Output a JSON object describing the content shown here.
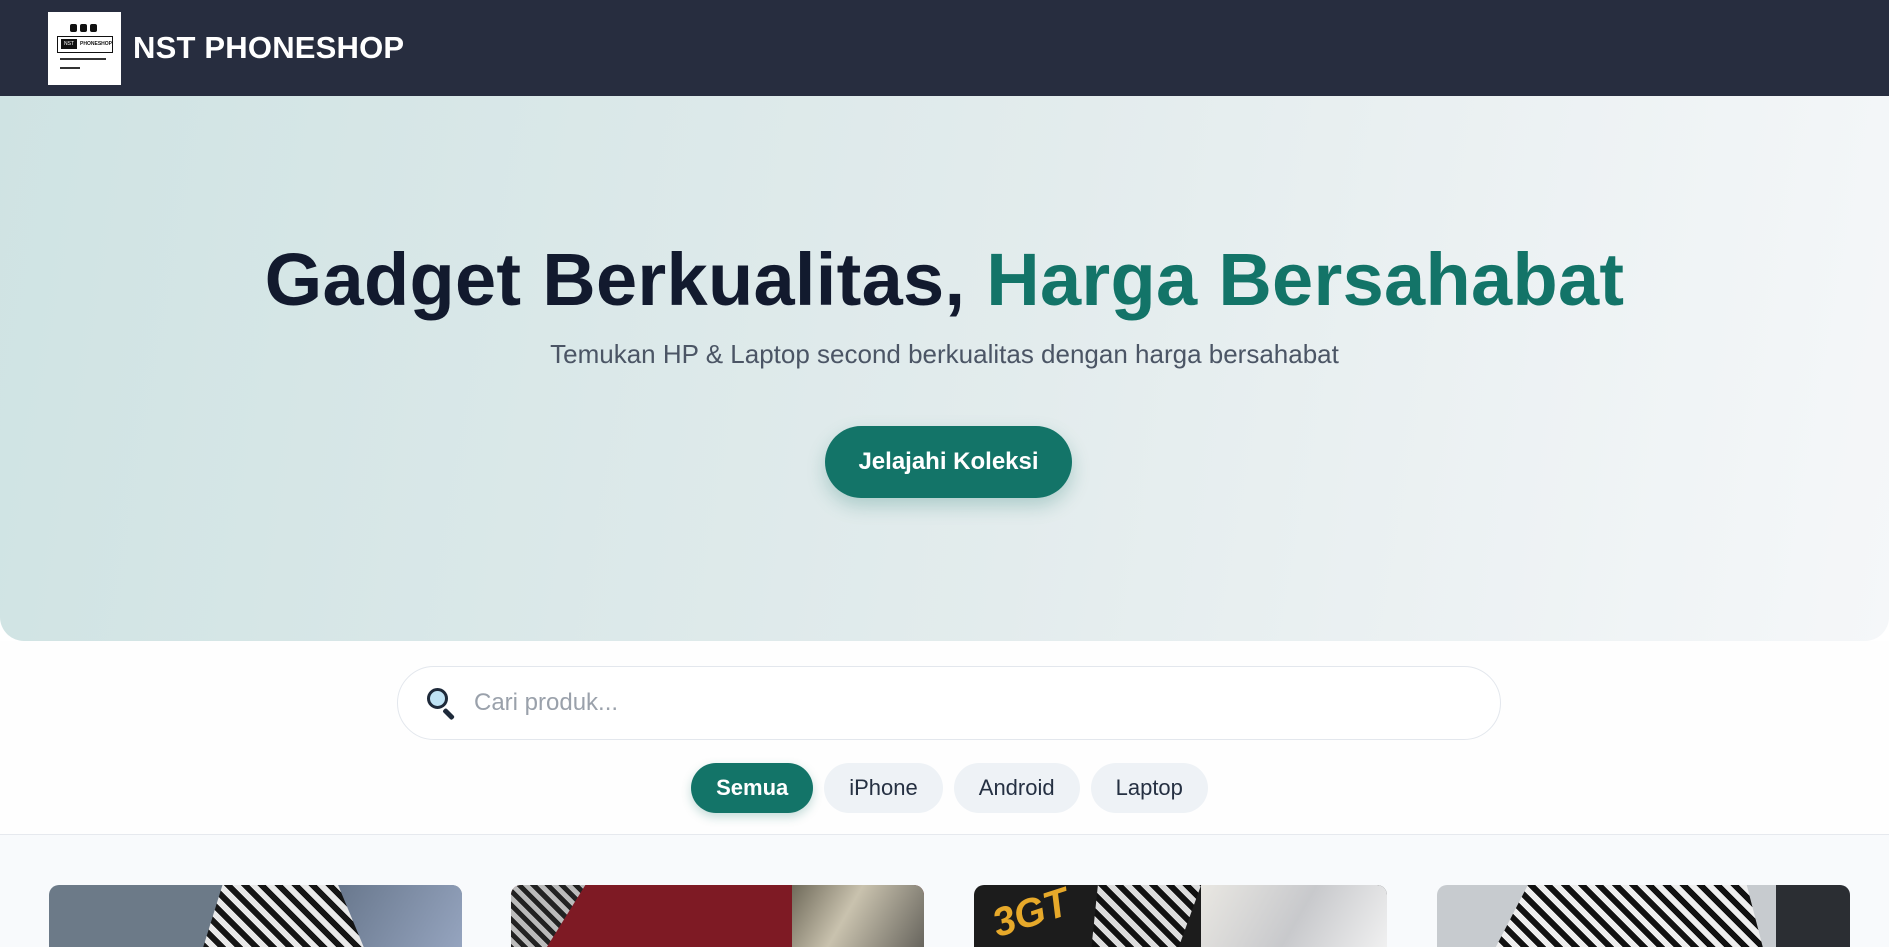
{
  "header": {
    "brand": "NST PHONESHOP",
    "logo": {
      "name": "nst-phoneshop-logo",
      "text_left": "NST",
      "text_right": "PHONESHOP"
    }
  },
  "hero": {
    "title_main": "Gadget Berkualitas, ",
    "title_accent": "Harga Bersahabat",
    "subtitle": "Temukan HP & Laptop second berkualitas dengan harga bersahabat",
    "cta_label": "Jelajahi Koleksi"
  },
  "search": {
    "icon": "search-icon",
    "placeholder": "Cari produk...",
    "value": ""
  },
  "filters": {
    "items": [
      "Semua",
      "iPhone",
      "Android",
      "Laptop"
    ],
    "active": "Semua"
  },
  "products": {
    "cards": [
      {
        "image": "product-image-1"
      },
      {
        "image": "product-image-2"
      },
      {
        "image": "product-image-3",
        "image_text": "3GT"
      },
      {
        "image": "product-image-4"
      }
    ]
  },
  "colors": {
    "header_bg": "#272d3f",
    "accent": "#137468",
    "title_dark": "#121a2e",
    "chip_bg": "#eef2f6"
  }
}
